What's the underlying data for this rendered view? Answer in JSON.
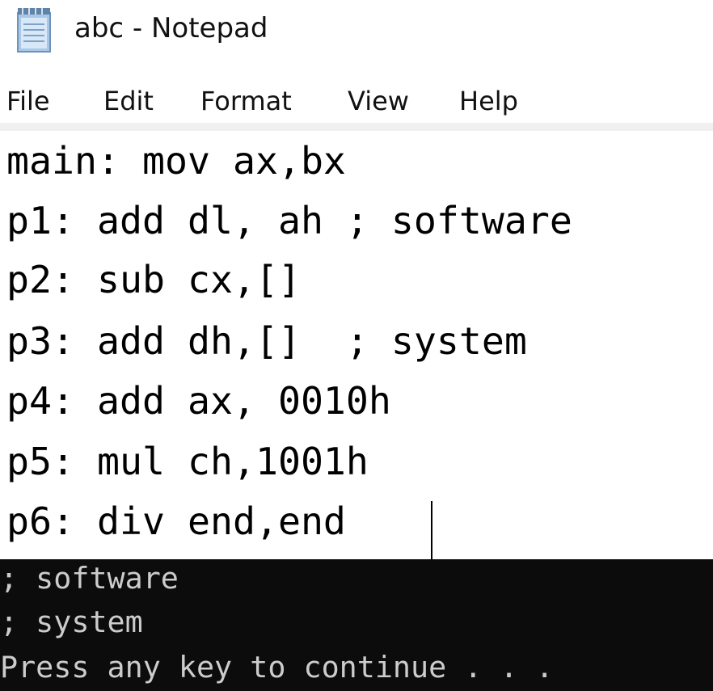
{
  "window": {
    "title": "abc - Notepad",
    "icon": "notepad-icon"
  },
  "menu": {
    "items": [
      "File",
      "Edit",
      "Format",
      "View",
      "Help"
    ]
  },
  "editor": {
    "lines": [
      "main: mov ax,bx",
      "p1: add dl, ah ; software",
      "p2: sub cx,[]",
      "p3: add dh,[]  ; system",
      "p4: add ax, 0010h",
      "p5: mul ch,1001h",
      "p6: div end,end"
    ]
  },
  "console": {
    "lines": [
      "; software",
      "; system",
      "Press any key to continue . . ."
    ]
  }
}
